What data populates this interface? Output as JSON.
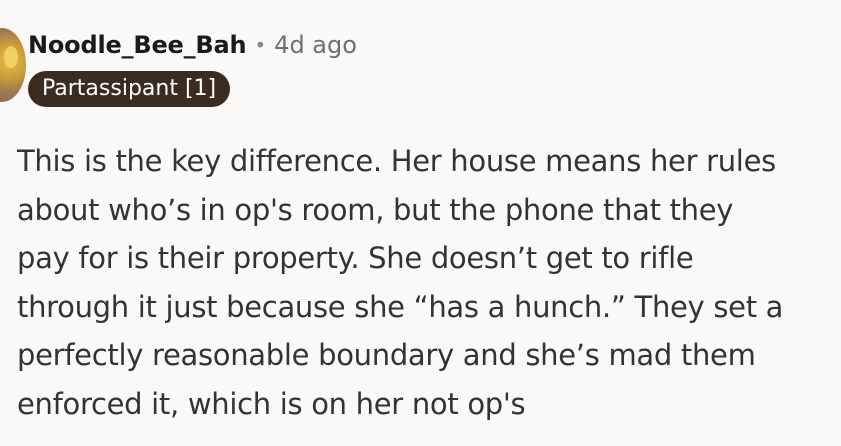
{
  "author": {
    "username": "Noodle_Bee_Bah",
    "separator": "•",
    "time_ago": "4d ago",
    "flair": "Partassipant [1]"
  },
  "comment": {
    "lines": [
      "This is the key difference. Her house means her rules",
      "about who’s in op's room, but the phone that they",
      "pay for is their property. She doesn’t get to rifle",
      "through it just because she “has a hunch.” They set a",
      "perfectly reasonable boundary and she’s mad them",
      "enforced it, which is on her not op's"
    ]
  },
  "colors": {
    "background": "#fbf9f7",
    "flair_background": "#3b2c22",
    "flair_text": "#ffffff",
    "username": "#1a1a1a",
    "timestamp": "#6f6f6f",
    "body_text": "#333333"
  },
  "icons": {
    "avatar": "user-avatar"
  }
}
